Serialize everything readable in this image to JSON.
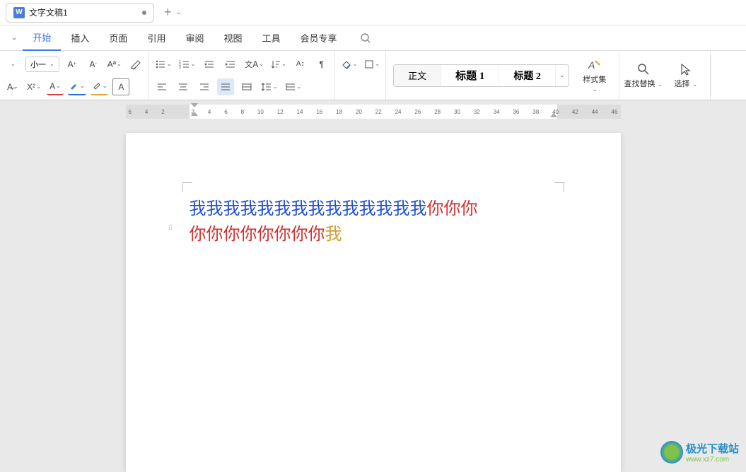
{
  "tab": {
    "icon": "W",
    "title": "文字文稿1"
  },
  "menu": {
    "items": [
      "开始",
      "插入",
      "页面",
      "引用",
      "审阅",
      "视图",
      "工具",
      "会员专享"
    ],
    "active": 0
  },
  "font": {
    "size": "小一"
  },
  "styles": {
    "items": [
      "正文",
      "标题 1",
      "标题 2"
    ],
    "selected": 0,
    "label": "样式集"
  },
  "actions": {
    "find": "查找替换",
    "select": "选择"
  },
  "ruler": {
    "nums": [
      "6",
      "4",
      "2",
      "",
      "2",
      "4",
      "6",
      "8",
      "10",
      "12",
      "14",
      "16",
      "18",
      "20",
      "22",
      "24",
      "26",
      "28",
      "30",
      "32",
      "34",
      "36",
      "38",
      "40",
      "42",
      "44",
      "46"
    ]
  },
  "doc": {
    "line1_blue": "我我我我我我我我我我我我我我",
    "line1_red": "你你你",
    "line2_red": "你你你你你你你你",
    "line2_gold": "我"
  },
  "watermark": {
    "t1": "极光下载站",
    "t2": "www.xz7.com"
  }
}
